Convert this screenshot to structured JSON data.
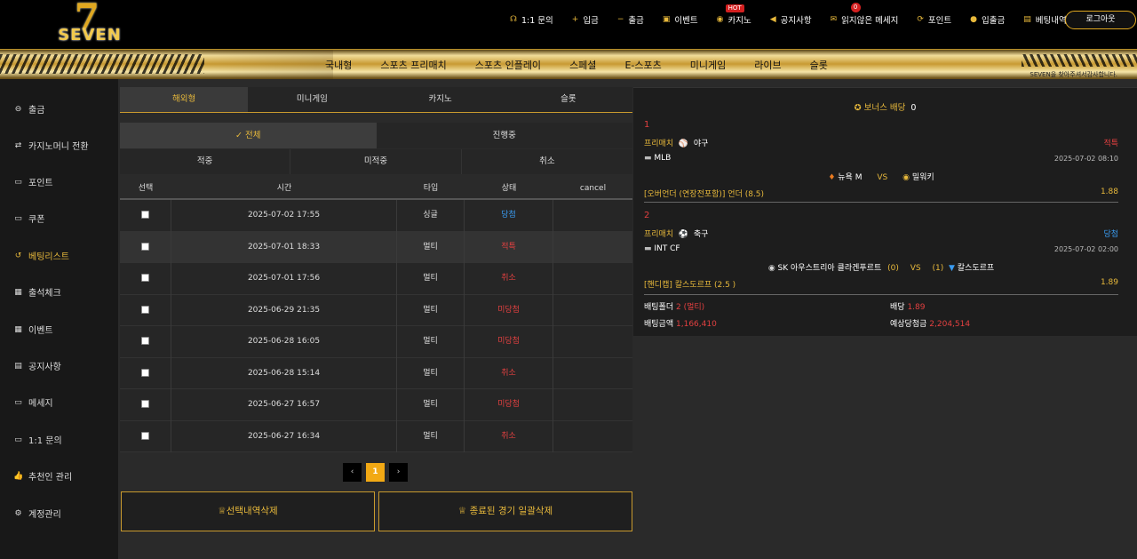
{
  "header": {
    "logo_text": "SEVEN",
    "logo_number": "7",
    "nav": [
      {
        "label": "1:1 문의",
        "icon": "headset-icon"
      },
      {
        "label": "입금",
        "icon": "plus-icon"
      },
      {
        "label": "출금",
        "icon": "minus-icon"
      },
      {
        "label": "이벤트",
        "icon": "gift-icon"
      },
      {
        "label": "카지노",
        "icon": "chip-icon",
        "badge": "HOT"
      },
      {
        "label": "공지사항",
        "icon": "megaphone-icon"
      },
      {
        "label": "읽지않은 메세지",
        "icon": "envelope-icon",
        "badge": "0"
      },
      {
        "label": "포인트",
        "icon": "refresh-icon"
      },
      {
        "label": "입출금",
        "icon": "moneybag-icon"
      },
      {
        "label": "베팅내역",
        "icon": "ticket-icon"
      }
    ],
    "logout_label": "로그아웃"
  },
  "main_nav": {
    "items": [
      "국내형",
      "스포츠 프리매치",
      "스포츠 인플레이",
      "스페셜",
      "E-스포츠",
      "미니게임",
      "라이브",
      "슬롯"
    ],
    "slogan": "SEVEN을 찾아주셔서감사합니다."
  },
  "sidebar": {
    "items": [
      {
        "label": "출금",
        "icon": "withdraw-icon"
      },
      {
        "label": "카지노머니 전환",
        "icon": "exchange-icon"
      },
      {
        "label": "포인트",
        "icon": "point-icon"
      },
      {
        "label": "쿠폰",
        "icon": "coupon-icon"
      },
      {
        "label": "베팅리스트",
        "icon": "history-icon",
        "active": true
      },
      {
        "label": "출석체크",
        "icon": "calendar-check-icon"
      },
      {
        "label": "이벤트",
        "icon": "calendar-gift-icon"
      },
      {
        "label": "공지사항",
        "icon": "clipboard-icon"
      },
      {
        "label": "메세지",
        "icon": "chat-icon"
      },
      {
        "label": "1:1 문의",
        "icon": "support-chat-icon"
      },
      {
        "label": "추천인 관리",
        "icon": "thumbs-up-icon"
      },
      {
        "label": "계정관리",
        "icon": "gear-icon"
      }
    ]
  },
  "tabs_category": [
    "해외형",
    "미니게임",
    "카지노",
    "슬롯"
  ],
  "tabs_status": [
    "✓ 전체",
    "진행중"
  ],
  "tabs_result": [
    "적중",
    "미적중",
    "취소"
  ],
  "table": {
    "headers": [
      "선택",
      "시간",
      "타입",
      "상태",
      "cancel"
    ],
    "rows": [
      {
        "time": "2025-07-02 17:55",
        "type": "싱글",
        "status": "당첨",
        "status_color": "blue"
      },
      {
        "time": "2025-07-01 18:33",
        "type": "멀티",
        "status": "적특",
        "status_color": "red"
      },
      {
        "time": "2025-07-01 17:56",
        "type": "멀티",
        "status": "취소",
        "status_color": "red"
      },
      {
        "time": "2025-06-29 21:35",
        "type": "멀티",
        "status": "미당첨",
        "status_color": "red"
      },
      {
        "time": "2025-06-28 16:05",
        "type": "멀티",
        "status": "미당첨",
        "status_color": "red"
      },
      {
        "time": "2025-06-28 15:14",
        "type": "멀티",
        "status": "취소",
        "status_color": "red"
      },
      {
        "time": "2025-06-27 16:57",
        "type": "멀티",
        "status": "미당첨",
        "status_color": "red"
      },
      {
        "time": "2025-06-27 16:34",
        "type": "멀티",
        "status": "취소",
        "status_color": "red"
      }
    ]
  },
  "pager": {
    "prev": "‹",
    "current": "1",
    "next": "›"
  },
  "buttons": {
    "delete_selected": "선택내역삭제",
    "delete_finished": "종료된 경기 일괄삭제"
  },
  "detail": {
    "bonus_label": "보너스 배당",
    "bonus_value": "0",
    "bets": [
      {
        "num": "1",
        "category": "프리매치",
        "sport": "야구",
        "result": "적특",
        "league": "MLB",
        "datetime": "2025-07-02 08:10",
        "home": "뉴욕 M",
        "vs": "VS",
        "away": "밀워키",
        "pick": "[오버언더 (연장전포함)] 언더 (8.5)",
        "odds": "1.88"
      },
      {
        "num": "2",
        "category": "프리매치",
        "sport": "축구",
        "result": "당첨",
        "league": "INT CF",
        "datetime": "2025-07-02 02:00",
        "home": "SK 아우스트리아 클라겐푸르트",
        "home_score": "(0)",
        "vs": "VS",
        "away_score": "(1)",
        "away": "칼스도르프",
        "pick": "[핸디캡] 칼스도르프 (2.5 )",
        "odds": "1.89"
      }
    ],
    "summary": {
      "folder_label": "배팅폴더",
      "folder_value": "2 (멀티)",
      "odds_label": "배당",
      "odds_value": "1.89",
      "amount_label": "배팅금액",
      "amount_value": "1,166,410",
      "expected_label": "예상당첨금",
      "expected_value": "2,204,514"
    }
  }
}
